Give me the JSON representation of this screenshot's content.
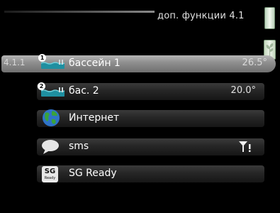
{
  "header": {
    "title": "доп. функции 4.1"
  },
  "menu": {
    "items": [
      {
        "prefix": "4.1.1",
        "label": "бассейн  1",
        "value": "26.5°",
        "badge": "1",
        "icon": "pool-icon"
      },
      {
        "prefix": "",
        "label": "бас. 2",
        "value": "20.0°",
        "badge": "2",
        "icon": "pool-icon"
      },
      {
        "prefix": "",
        "label": "Интернет",
        "value": "",
        "badge": "",
        "icon": "globe-icon"
      },
      {
        "prefix": "",
        "label": "sms",
        "value": "",
        "badge": "",
        "icon": "chat-bubble-icon"
      },
      {
        "prefix": "",
        "label": "SG Ready",
        "value": "",
        "badge": "",
        "icon": "sg-ready-icon"
      }
    ]
  },
  "sg_icon": {
    "top": "SG",
    "bottom": "Ready"
  },
  "colors": {
    "pool": "#1f8fa0",
    "globe_ocean": "#2f73c8",
    "globe_land": "#3aa33a",
    "accent_scroll": "#dbe9d6"
  }
}
